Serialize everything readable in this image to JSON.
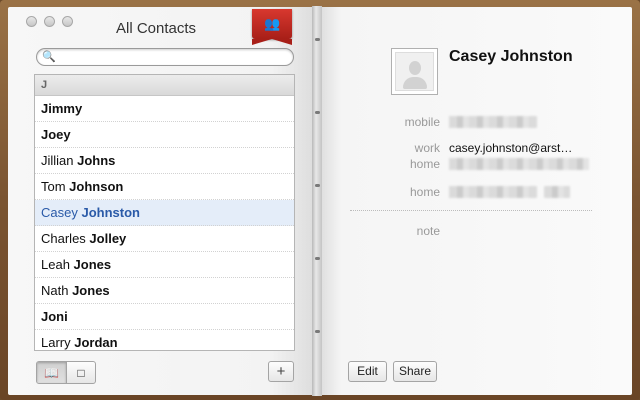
{
  "window": {
    "title": "All Contacts"
  },
  "search": {
    "placeholder": ""
  },
  "list": {
    "section": "J",
    "rows": [
      {
        "first": "",
        "last": "Jimmy",
        "selected": false
      },
      {
        "first": "",
        "last": "Joey",
        "selected": false
      },
      {
        "first": "Jillian ",
        "last": "Johns",
        "selected": false
      },
      {
        "first": "Tom ",
        "last": "Johnson",
        "selected": false
      },
      {
        "first": "Casey ",
        "last": "Johnston",
        "selected": true
      },
      {
        "first": "Charles ",
        "last": "Jolley",
        "selected": false
      },
      {
        "first": "Leah ",
        "last": "Jones",
        "selected": false
      },
      {
        "first": "Nath ",
        "last": "Jones",
        "selected": false
      },
      {
        "first": "",
        "last": "Joni",
        "selected": false
      },
      {
        "first": "Larry ",
        "last": "Jordan",
        "selected": false
      }
    ]
  },
  "toolbar": {
    "add_symbol": "+",
    "book_icon": "open-book-icon",
    "card_icon": "single-card-icon"
  },
  "contact": {
    "name": "Casey Johnston",
    "fields": [
      {
        "label": "mobile",
        "value": "",
        "blurred": true
      },
      {
        "label": "work",
        "value": "casey.johnston@arst…",
        "blurred": false
      },
      {
        "label": "home",
        "value": "",
        "blurred": true
      },
      {
        "label": "home",
        "value": "",
        "blurred": true
      },
      {
        "label": "note",
        "value": "",
        "blurred": false
      }
    ],
    "edit_label": "Edit",
    "share_label": "Share"
  },
  "colors": {
    "bookmark": "#c62a22",
    "selected_row": "#e4edf9",
    "selected_text": "#2a5aa8"
  }
}
